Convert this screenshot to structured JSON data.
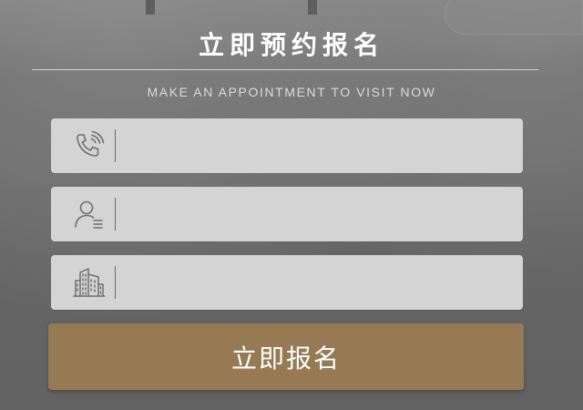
{
  "header": {
    "title": "立即预约报名",
    "subtitle": "MAKE AN APPOINTMENT TO VISIT NOW"
  },
  "form": {
    "fields": [
      {
        "name": "phone",
        "icon": "phone-icon",
        "value": "",
        "placeholder": ""
      },
      {
        "name": "name",
        "icon": "user-icon",
        "value": "",
        "placeholder": ""
      },
      {
        "name": "community",
        "icon": "building-icon",
        "value": "",
        "placeholder": ""
      }
    ],
    "submit_label": "立即报名"
  },
  "colors": {
    "background": "#5f5f5f",
    "field_bg": "#d4d4d4",
    "button_bg": "#957a54",
    "text_light": "#ffffff",
    "icon_stroke": "#6f6f6f"
  }
}
